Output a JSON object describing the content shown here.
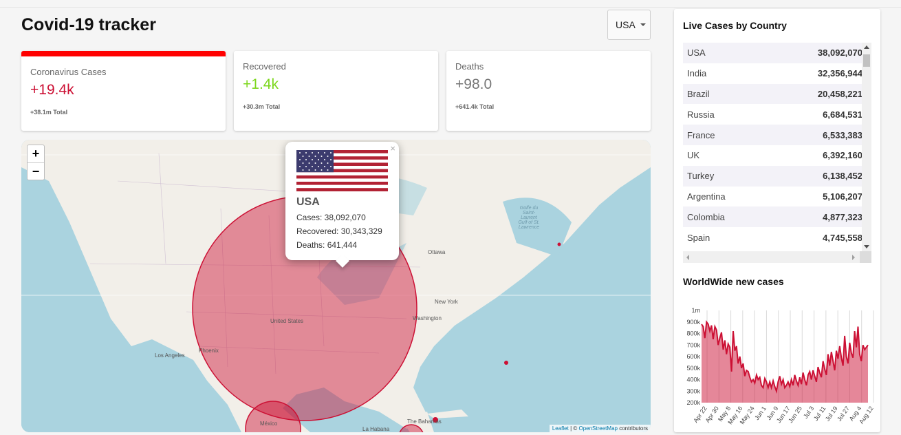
{
  "app": {
    "title": "Covid-19 tracker"
  },
  "country_select": {
    "value": "USA"
  },
  "stats": [
    {
      "title": "Coronavirus Cases",
      "value": "+19.4k",
      "total": "+38.1m Total"
    },
    {
      "title": "Recovered",
      "value": "+1.4k",
      "total": "+30.3m Total"
    },
    {
      "title": "Deaths",
      "value": "+98.0",
      "total": "+641.4k Total"
    }
  ],
  "colors": {
    "cases": "#cc1034",
    "recovered": "#7dd71d",
    "deaths": "#777777",
    "active_bar": "#ff0000"
  },
  "map": {
    "zoom_in": "+",
    "zoom_out": "−",
    "labels": {
      "united_states": "United States",
      "los_angeles": "Los Angeles",
      "phoenix": "Phoenix",
      "ottawa": "Ottawa",
      "new_york": "New York",
      "washington": "Washington",
      "mexico": "México",
      "la_habana": "La Habana",
      "bahamas": "The Bahamas",
      "gulf": "Golfe du Saint-Laurent Gulf of St. Lawrence"
    },
    "popup": {
      "close": "×",
      "country": "USA",
      "cases": "Cases: 38,092,070",
      "recovered": "Recovered: 30,343,329",
      "deaths": "Deaths: 641,444"
    },
    "attribution": {
      "leaflet": "Leaflet",
      "sep": " | © ",
      "osm": "OpenStreetMap",
      "contrib": " contributors"
    }
  },
  "live_cases": {
    "title": "Live Cases by Country",
    "rows": [
      {
        "country": "USA",
        "cases": "38,092,070"
      },
      {
        "country": "India",
        "cases": "32,356,944"
      },
      {
        "country": "Brazil",
        "cases": "20,458,221"
      },
      {
        "country": "Russia",
        "cases": "6,684,531"
      },
      {
        "country": "France",
        "cases": "6,533,383"
      },
      {
        "country": "UK",
        "cases": "6,392,160"
      },
      {
        "country": "Turkey",
        "cases": "6,138,452"
      },
      {
        "country": "Argentina",
        "cases": "5,106,207"
      },
      {
        "country": "Colombia",
        "cases": "4,877,323"
      },
      {
        "country": "Spain",
        "cases": "4,745,558"
      }
    ]
  },
  "worldwide": {
    "title": "WorldWide new cases"
  },
  "chart_data": {
    "type": "area",
    "title": "WorldWide new cases",
    "x": [
      "Apr 22",
      "Apr 30",
      "May 8",
      "May 16",
      "May 24",
      "Jun 1",
      "Jun 9",
      "Jun 17",
      "Jun 25",
      "Jul 3",
      "Jul 11",
      "Jul 19",
      "Jul 27",
      "Aug 4",
      "Aug 12"
    ],
    "yticks": [
      "200k",
      "300k",
      "400k",
      "500k",
      "600k",
      "700k",
      "800k",
      "900k",
      "1m"
    ],
    "ylim": [
      200000,
      1000000
    ],
    "color": "#cc1034",
    "values": [
      880000,
      860000,
      760000,
      900000,
      880000,
      820000,
      870000,
      750000,
      860000,
      830000,
      700000,
      760000,
      810000,
      660000,
      740000,
      620000,
      710000,
      680000,
      470000,
      820000,
      650000,
      690000,
      540000,
      600000,
      500000,
      540000,
      430000,
      480000,
      470000,
      420000,
      380000,
      400000,
      370000,
      440000,
      400000,
      420000,
      350000,
      330000,
      410000,
      380000,
      330000,
      380000,
      330000,
      390000,
      340000,
      300000,
      380000,
      430000,
      360000,
      400000,
      330000,
      350000,
      380000,
      340000,
      400000,
      350000,
      440000,
      390000,
      350000,
      420000,
      360000,
      460000,
      400000,
      350000,
      440000,
      470000,
      400000,
      480000,
      430000,
      380000,
      510000,
      460000,
      420000,
      560000,
      490000,
      440000,
      620000,
      520000,
      640000,
      560000,
      480000,
      650000,
      580000,
      690000,
      590000,
      520000,
      780000,
      600000,
      540000,
      720000,
      630000,
      590000,
      820000,
      680000,
      860000,
      620000,
      560000,
      700000,
      660000,
      680000,
      700000
    ]
  }
}
